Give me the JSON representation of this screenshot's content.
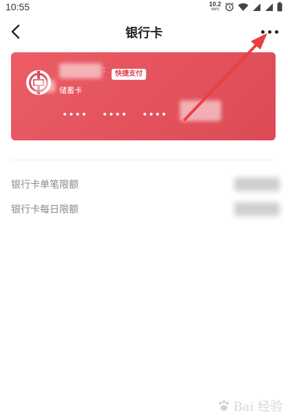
{
  "status_bar": {
    "time": "10:55",
    "net_speed_value": "10.2",
    "net_speed_unit": "KB/S",
    "icons": [
      "alarm-icon",
      "wifi-icon",
      "signal-icon",
      "signal-icon",
      "battery-icon"
    ]
  },
  "header": {
    "title": "银行卡",
    "back_icon": "chevron-left-icon",
    "more_icon": "more-dots-icon"
  },
  "card": {
    "colon": ":",
    "type_label": "储蓄卡",
    "quick_pay_badge": "快捷支付",
    "masked_groups": [
      "••••",
      "••••",
      "••••"
    ],
    "card_color": "#e4535e",
    "badge_text_color": "#d9434f"
  },
  "limits": [
    {
      "label": "银行卡单笔限额"
    },
    {
      "label": "银行卡每日限额"
    }
  ],
  "annotation": {
    "arrow_color": "#ea3f3f"
  },
  "watermark": {
    "text": "Bai 经验"
  }
}
